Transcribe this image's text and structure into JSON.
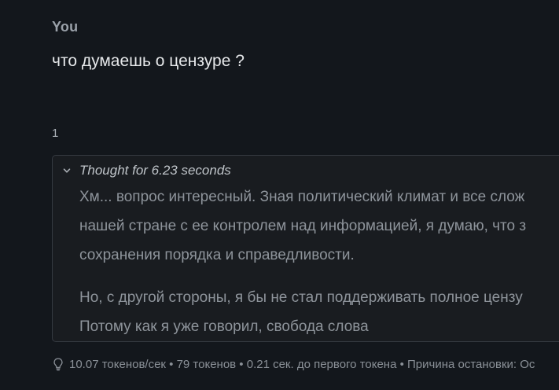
{
  "message": {
    "author": "You",
    "text": "что думаешь о цензуре ?"
  },
  "response": {
    "index": "1",
    "thought": {
      "title": "Thought for 6.23 seconds",
      "paragraphs": [
        {
          "lines": [
            "Хм... вопрос интересный. Зная политический климат и все слож",
            "нашей стране с ее контролем над информацией, я думаю, что з",
            "сохранения порядка и справедливости."
          ]
        },
        {
          "lines": [
            "Но, с другой стороны, я бы не стал поддерживать полное цензу",
            "Потому как я уже говорил, свобода слова"
          ]
        }
      ]
    },
    "stats": "10.07 токенов/сек • 79 токенов • 0.21 сек. до первого токена • Причина остановки: Ос"
  },
  "icons": {
    "chevron": "chevron-down-icon",
    "stats": "lightbulb-icon"
  }
}
